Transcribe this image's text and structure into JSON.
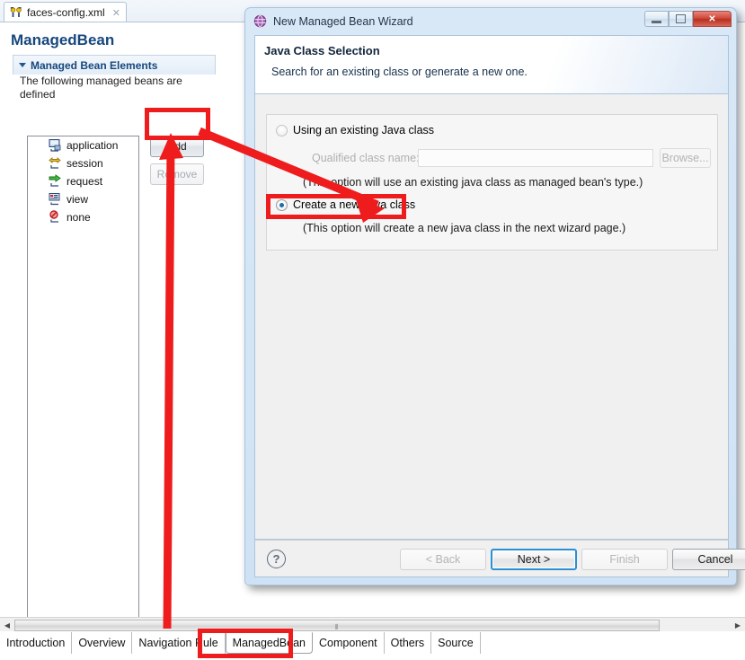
{
  "editor": {
    "tab": {
      "label": "faces-config.xml",
      "icon": "faces-config-icon",
      "close": "✕"
    },
    "page_title": "ManagedBean",
    "section": {
      "title": "Managed Bean Elements",
      "description": "The following managed beans are defined"
    },
    "tree_items": [
      {
        "label": "application",
        "icon": "application-scope-icon"
      },
      {
        "label": "session",
        "icon": "session-scope-icon"
      },
      {
        "label": "request",
        "icon": "request-scope-icon"
      },
      {
        "label": "view",
        "icon": "view-scope-icon"
      },
      {
        "label": "none",
        "icon": "none-scope-icon"
      }
    ],
    "buttons": {
      "add": "Add",
      "remove": "Remove"
    },
    "bottom_tabs": [
      {
        "label": "Introduction",
        "selected": false
      },
      {
        "label": "Overview",
        "selected": false
      },
      {
        "label": "Navigation Rule",
        "selected": false
      },
      {
        "label": "ManagedBean",
        "selected": true
      },
      {
        "label": "Component",
        "selected": false
      },
      {
        "label": "Others",
        "selected": false
      },
      {
        "label": "Source",
        "selected": false
      }
    ],
    "scrollbar": {
      "left_arrow": "◀",
      "right_arrow": "▶",
      "grip": "⦀"
    }
  },
  "dialog": {
    "title": "New Managed Bean Wizard",
    "title_icon": "wizard-bean-icon",
    "window_buttons": {
      "minimize": "minimize-icon",
      "maximize": "maximize-icon",
      "close": "✕"
    },
    "heading": "Java Class Selection",
    "subheading": "Search for an existing class or generate a new one.",
    "options": {
      "existing": {
        "label": "Using an existing Java class",
        "selected": false,
        "hint": "(This option will use an existing java class as managed bean's type.)",
        "field_label": "Qualified class name:",
        "field_value": "",
        "field_placeholder": "",
        "browse_label": "Browse..."
      },
      "create_new": {
        "label": "Create a new Java class",
        "selected": true,
        "hint": "(This option will create a new java class in the next wizard page.)"
      }
    },
    "help_icon": "?",
    "buttons": {
      "back": "< Back",
      "next": "Next >",
      "finish": "Finish",
      "cancel": "Cancel"
    }
  },
  "annotations": {
    "color": "#ee1c1c",
    "highlights": [
      "add-button",
      "create-a-new-java-class-radio",
      "managedbean-tab"
    ],
    "arrows": [
      "add-to-create-new-java-class",
      "add-to-managedbean-tab"
    ]
  }
}
